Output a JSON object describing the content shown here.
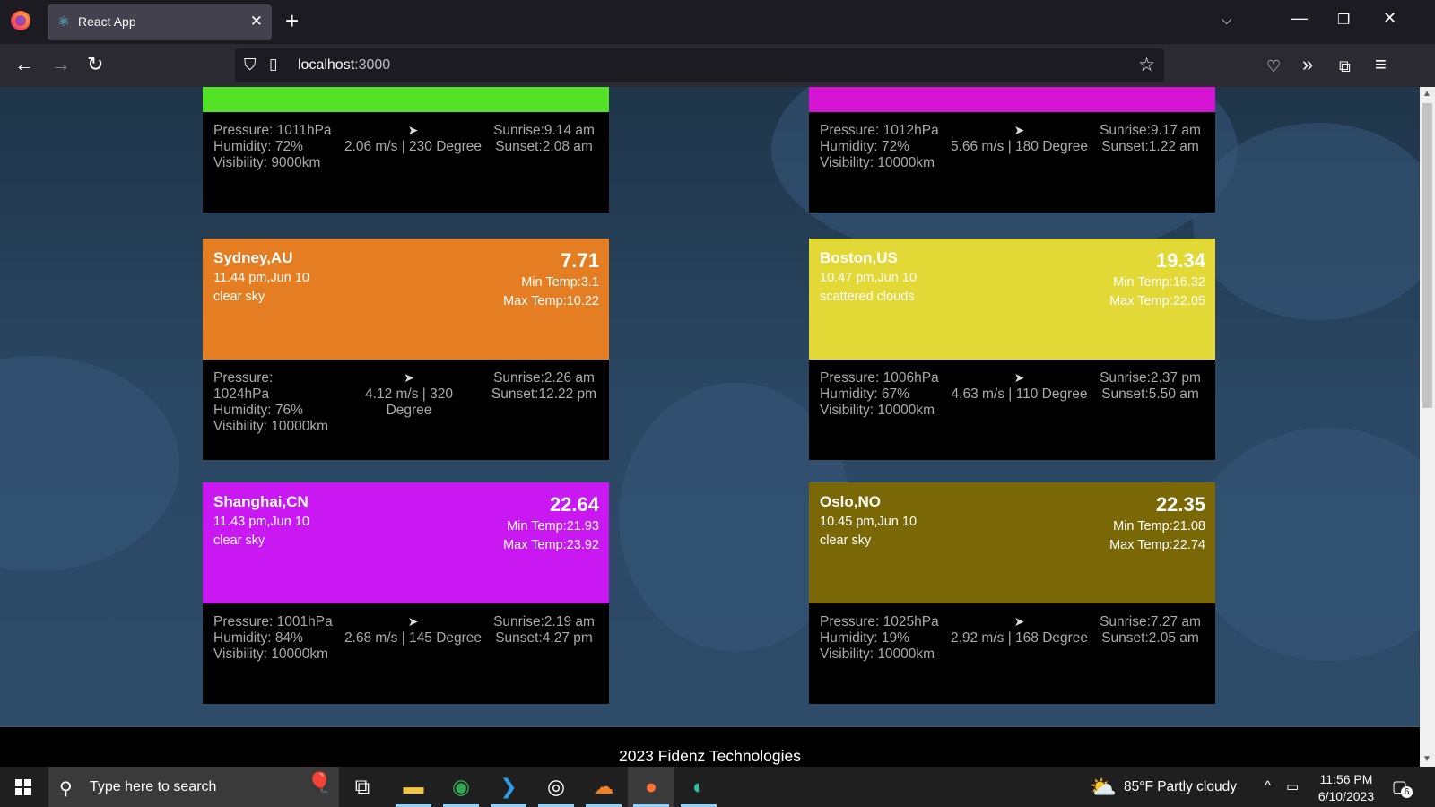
{
  "browser": {
    "tab_title": "React App",
    "url_host": "localhost",
    "url_port": ":3000"
  },
  "cards_partial": [
    {
      "color": "#52e326",
      "pressure": "Pressure: 1011hPa",
      "humidity": "Humidity: 72%",
      "visibility": "Visibility: 9000km",
      "wind": "2.06 m/s | 230 Degree",
      "sunrise": "Sunrise:9.14 am",
      "sunset": "Sunset:2.08 am"
    },
    {
      "color": "#d514d4",
      "pressure": "Pressure: 1012hPa",
      "humidity": "Humidity: 72%",
      "visibility": "Visibility: 10000km",
      "wind": "5.66 m/s | 180 Degree",
      "sunrise": "Sunrise:9.17 am",
      "sunset": "Sunset:1.22 am"
    }
  ],
  "cards": [
    {
      "city": "Sydney,AU",
      "datetime": "11.44 pm,Jun 10",
      "desc": "clear sky",
      "temp": "7.71",
      "min_temp": "Min Temp:3.1",
      "max_temp": "Max Temp:10.22",
      "color": "#e57e22",
      "pressure": "Pressure: 1024hPa",
      "humidity": "Humidity: 76%",
      "visibility": "Visibility: 10000km",
      "wind": "4.12 m/s | 320 Degree",
      "sunrise": "Sunrise:2.26 am",
      "sunset": "Sunset:12.22 pm"
    },
    {
      "city": "Boston,US",
      "datetime": "10.47 pm,Jun 10",
      "desc": "scattered clouds",
      "temp": "19.34",
      "min_temp": "Min Temp:16.32",
      "max_temp": "Max Temp:22.05",
      "color": "#e2d836",
      "pressure": "Pressure: 1006hPa",
      "humidity": "Humidity: 67%",
      "visibility": "Visibility: 10000km",
      "wind": "4.63 m/s | 110 Degree",
      "sunrise": "Sunrise:2.37 pm",
      "sunset": "Sunset:5.50 am"
    },
    {
      "city": "Shanghai,CN",
      "datetime": "11.43 pm,Jun 10",
      "desc": "clear sky",
      "temp": "22.64",
      "min_temp": "Min Temp:21.93",
      "max_temp": "Max Temp:23.92",
      "color": "#c918f1",
      "pressure": "Pressure: 1001hPa",
      "humidity": "Humidity: 84%",
      "visibility": "Visibility: 10000km",
      "wind": "2.68 m/s | 145 Degree",
      "sunrise": "Sunrise:2.19 am",
      "sunset": "Sunset:4.27 pm"
    },
    {
      "city": "Oslo,NO",
      "datetime": "10.45 pm,Jun 10",
      "desc": "clear sky",
      "temp": "22.35",
      "min_temp": "Min Temp:21.08",
      "max_temp": "Max Temp:22.74",
      "color": "#7a6806",
      "pressure": "Pressure: 1025hPa",
      "humidity": "Humidity: 19%",
      "visibility": "Visibility: 10000km",
      "wind": "2.92 m/s | 168 Degree",
      "sunrise": "Sunrise:7.27 am",
      "sunset": "Sunset:2.05 am"
    }
  ],
  "footer": "2023 Fidenz Technologies",
  "taskbar": {
    "search_placeholder": "Type here to search",
    "weather": "85°F  Partly cloudy",
    "time": "11:56 PM",
    "date": "6/10/2023",
    "notification_count": "6"
  }
}
